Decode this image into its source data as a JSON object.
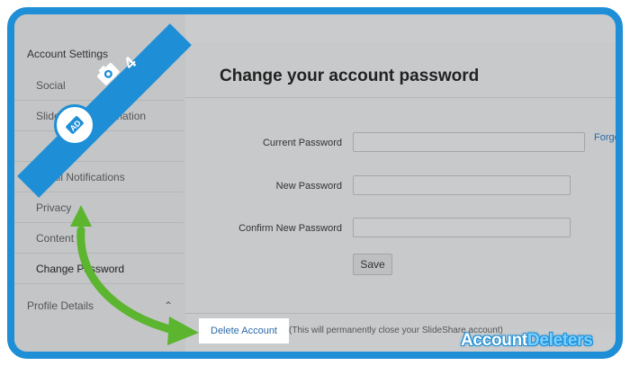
{
  "sidebar": {
    "header": "Account Settings",
    "items": [
      {
        "label": "Social"
      },
      {
        "label": "SlideShare Automation"
      },
      {
        "label": ""
      },
      {
        "label": "Email Notifications"
      },
      {
        "label": "Privacy"
      },
      {
        "label": "Content"
      },
      {
        "label": "Change Password"
      }
    ],
    "footer": "Profile Details"
  },
  "main": {
    "title": "Change your account password",
    "fields": [
      {
        "label": "Current Password",
        "value": ""
      },
      {
        "label": "New Password",
        "value": ""
      },
      {
        "label": "Confirm New Password",
        "value": ""
      }
    ],
    "forgot_link": "Forgot",
    "save_label": "Save"
  },
  "delete": {
    "link": "Delete Account",
    "note": "(This will permanently close your SlideShare account)"
  },
  "overlay": {
    "step_number": "4",
    "brand_part1": "Account",
    "brand_part2": "Deleters",
    "frame_color": "#1e8fd6",
    "arrow_color": "#5cb52e"
  }
}
